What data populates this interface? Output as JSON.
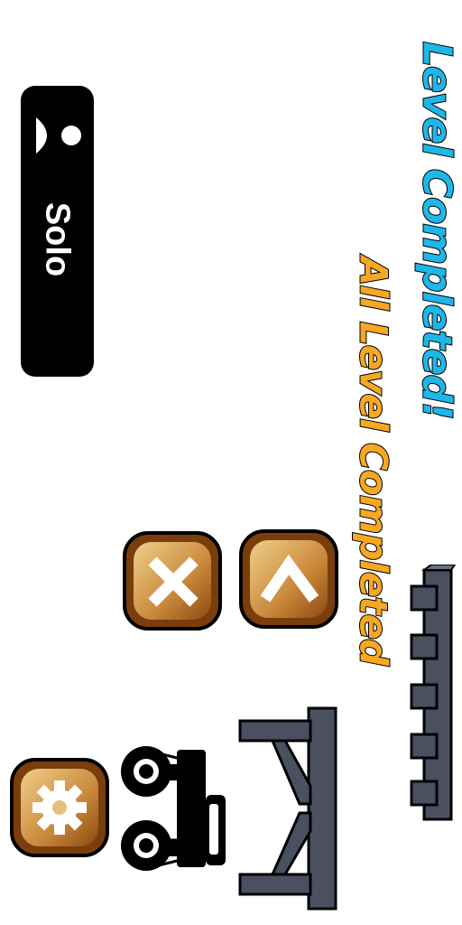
{
  "messages": {
    "level_completed": "Level Completed!",
    "all_level_completed": "All Level Completed"
  },
  "mode_button": {
    "label": "Solo",
    "icon": "person-icon"
  },
  "buttons": [
    {
      "name": "close-button",
      "icon": "close-x-icon"
    },
    {
      "name": "back-button",
      "icon": "chevron-left-icon"
    },
    {
      "name": "settings-button",
      "icon": "gear-icon"
    }
  ],
  "colors": {
    "title_blue": "#1fb6e8",
    "title_orange": "#f7a823",
    "button_brown": "#8a4a10",
    "button_tan": "#e7bf7a",
    "girder": "#4a5060"
  }
}
